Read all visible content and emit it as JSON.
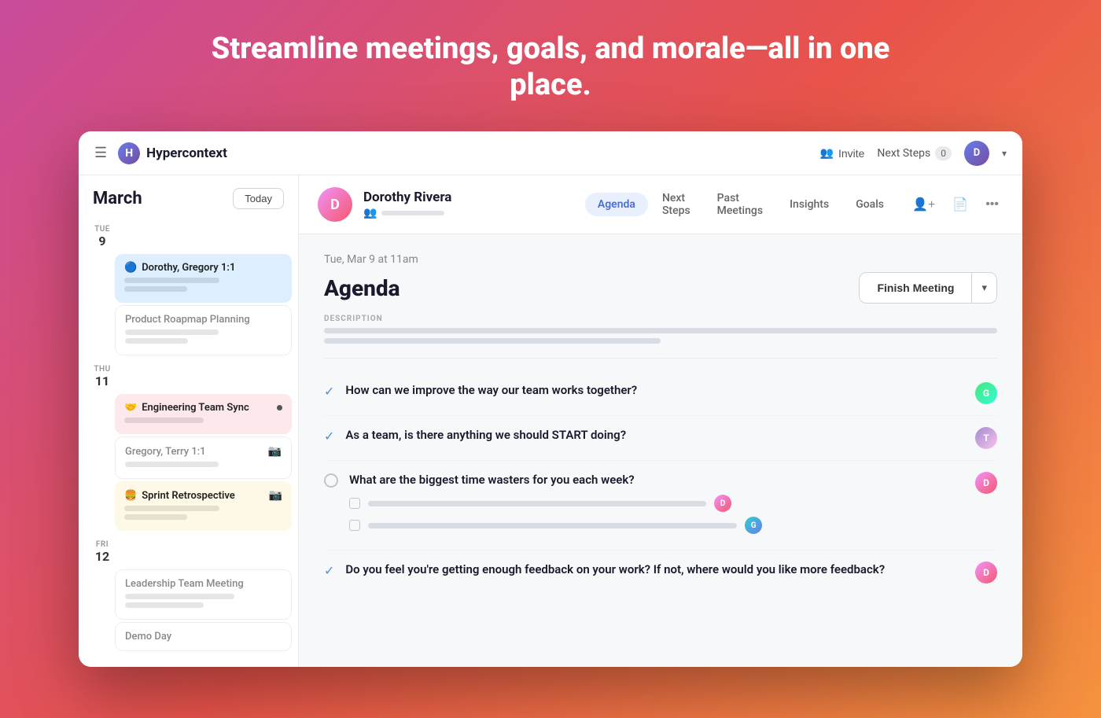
{
  "hero": {
    "title": "Streamline meetings, goals, and morale—all in one place."
  },
  "nav": {
    "brand": "Hypercontext",
    "invite_label": "Invite",
    "next_steps_label": "Next Steps",
    "next_steps_count": "0"
  },
  "sidebar": {
    "month_label": "March",
    "today_btn": "Today",
    "days": [
      {
        "day_name": "TUE",
        "day_number": "9",
        "meetings": [
          {
            "title": "Dorothy, Gregory 1:1",
            "style": "active-blue",
            "has_dot": false,
            "emoji": "🔵"
          },
          {
            "title": "Product Roapmap Planning",
            "style": "inactive",
            "has_dot": false,
            "emoji": ""
          }
        ]
      },
      {
        "day_name": "THU",
        "day_number": "11",
        "meetings": [
          {
            "title": "Engineering Team Sync",
            "style": "active-pink",
            "has_dot": true,
            "emoji": "🤝"
          },
          {
            "title": "Gregory, Terry 1:1",
            "style": "inactive",
            "has_dot": false,
            "emoji": ""
          },
          {
            "title": "Sprint Retrospective",
            "style": "active-yellow",
            "has_dot": false,
            "emoji": "🍔"
          }
        ]
      },
      {
        "day_name": "FRI",
        "day_number": "12",
        "meetings": [
          {
            "title": "Leadership Team Meeting",
            "style": "inactive",
            "has_dot": false,
            "emoji": ""
          },
          {
            "title": "Demo Day",
            "style": "inactive",
            "has_dot": false,
            "emoji": ""
          }
        ]
      }
    ]
  },
  "meeting_panel": {
    "person_name": "Dorothy Rivera",
    "date_label": "Tue, Mar 9 at 11am",
    "agenda_title": "Agenda",
    "description_label": "DESCRIPTION",
    "finish_meeting_btn": "Finish Meeting",
    "tabs": [
      {
        "label": "Agenda",
        "active": true
      },
      {
        "label": "Next Steps",
        "active": false
      },
      {
        "label": "Past Meetings",
        "active": false
      },
      {
        "label": "Insights",
        "active": false
      },
      {
        "label": "Goals",
        "active": false
      }
    ],
    "agenda_items": [
      {
        "type": "checked",
        "question": "How can we improve the way our team works together?",
        "avatar_style": "av-green"
      },
      {
        "type": "checked",
        "question": "As a team, is there anything we should START doing?",
        "avatar_style": "av-multi"
      },
      {
        "type": "circle",
        "question": "What are the biggest time wasters for you each week?",
        "avatar_style": "av-pink",
        "has_sub_items": true
      },
      {
        "type": "checked",
        "question": "Do you feel you're getting enough feedback on your work? If not, where would you like more feedback?",
        "avatar_style": "av-pink"
      }
    ]
  }
}
